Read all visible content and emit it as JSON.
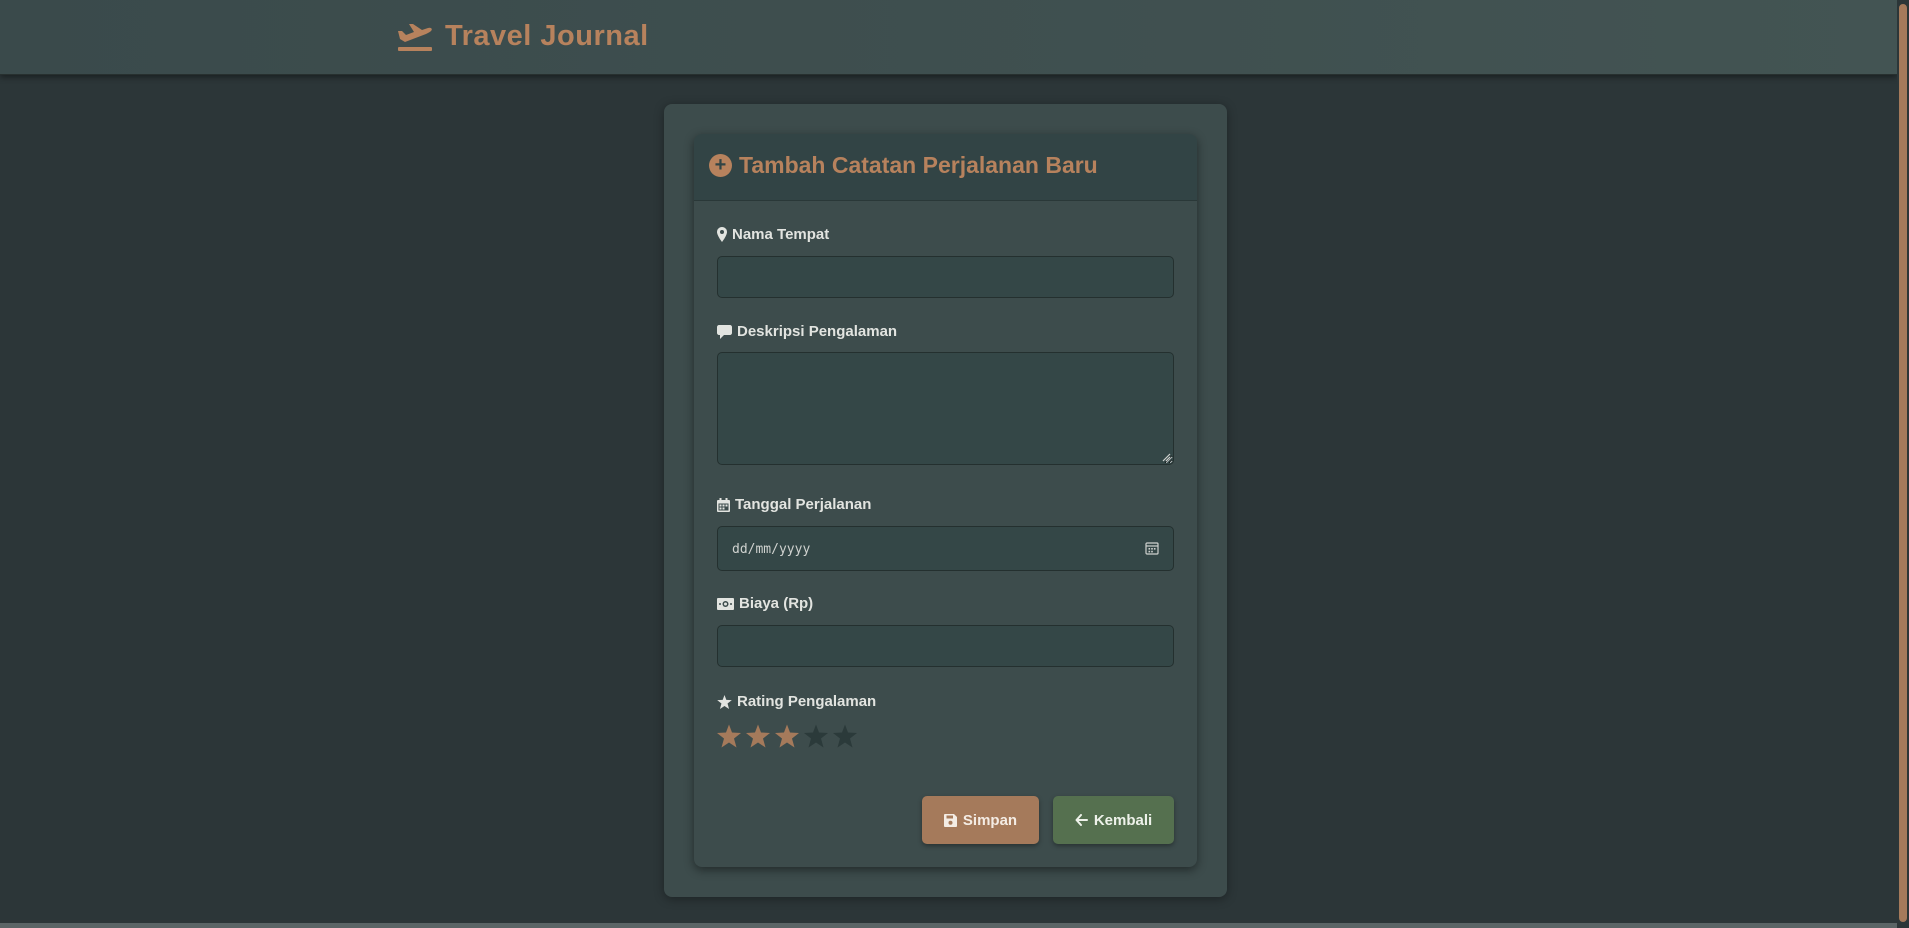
{
  "navbar": {
    "brand_title": "Travel Journal",
    "brand_icon": "plane-departure-icon"
  },
  "form": {
    "title": "Tambah Catatan Perjalanan Baru",
    "title_icon": "plus-circle-icon",
    "fields": {
      "place": {
        "label": "Nama Tempat",
        "icon": "map-marker-icon",
        "value": "",
        "placeholder": ""
      },
      "description": {
        "label": "Deskripsi Pengalaman",
        "icon": "comment-icon",
        "value": "",
        "placeholder": ""
      },
      "date": {
        "label": "Tanggal Perjalanan",
        "icon": "calendar-icon",
        "display": "dd/mm/yyyy"
      },
      "cost": {
        "label": "Biaya (Rp)",
        "icon": "money-icon",
        "value": "",
        "placeholder": ""
      },
      "rating": {
        "label": "Rating Pengalaman",
        "icon": "star-icon",
        "value": 3,
        "max": 5
      }
    },
    "buttons": {
      "save_label": "Simpan",
      "back_label": "Kembali"
    }
  },
  "colors": {
    "accent": "#b7825d",
    "page_bg": "#2c3638",
    "card_bg": "#3d4c4c",
    "input_bg": "#344747",
    "star_active": "#a57a5b",
    "star_inactive": "#2b3a3a",
    "save_button": "#a57a5b",
    "back_button": "#55704f"
  }
}
